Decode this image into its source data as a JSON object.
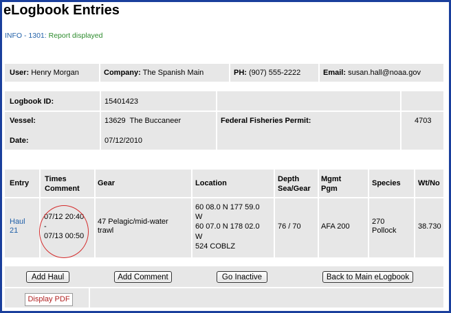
{
  "page": {
    "title": "eLogbook Entries",
    "info_code": "INFO - 1301:",
    "info_text": "Report displayed"
  },
  "user_bar": {
    "user_label": "User:",
    "user_value": "Henry Morgan",
    "company_label": "Company:",
    "company_value": "The Spanish Main",
    "phone_label": "PH:",
    "phone_value": "(907) 555-2222",
    "email_label": "Email:",
    "email_value": "susan.hall@noaa.gov"
  },
  "logbook": {
    "id_label": "Logbook ID:",
    "id_value": "15401423",
    "vessel_label": "Vessel:",
    "vessel_number": "13629",
    "vessel_name": "The Buccaneer",
    "permit_label": "Federal Fisheries Permit:",
    "permit_value": "4703",
    "date_label": "Date:",
    "date_value": "07/12/2010"
  },
  "table": {
    "headers": {
      "entry": "Entry",
      "times_1": "Times",
      "times_2": "Comment",
      "gear": "Gear",
      "location": "Location",
      "depth_1": "Depth",
      "depth_2": "Sea/Gear",
      "mgmt_1": "Mgmt",
      "mgmt_2": "Pgm",
      "species": "Species",
      "wt": "Wt/No"
    },
    "row": {
      "entry_1": "Haul",
      "entry_2": "21",
      "time_start": "07/12 20:40",
      "time_sep": "-",
      "time_end": "07/13 00:50",
      "gear_1": "47 Pelagic/mid-water",
      "gear_2": "trawl",
      "loc_1": "60 08.0 N  177 59.0",
      "loc_2": "W",
      "loc_3": "60 07.0 N  178 02.0",
      "loc_4": "W",
      "loc_5": "524  COBLZ",
      "depth": "76 / 70",
      "mgmt": "AFA 200",
      "species_1": "270",
      "species_2": "Pollock",
      "wt": "38.730"
    }
  },
  "actions": {
    "add_haul": "Add Haul",
    "add_comment": "Add Comment",
    "go_inactive": "Go Inactive",
    "back": "Back to Main eLogbook",
    "display_pdf": "Display PDF"
  },
  "colors": {
    "frame": "#1a3f9c",
    "band": "#e7e7e7",
    "link": "#1f5fa8",
    "info_ok": "#2a8a2a",
    "annotation_circle": "#d42a2a"
  }
}
